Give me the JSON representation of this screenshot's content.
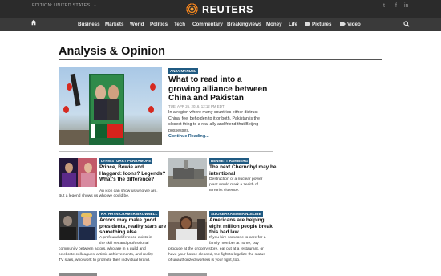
{
  "topbar": {
    "edition": "EDITION: UNITED STATES",
    "edition_chevron": "⌄",
    "logo_text": "REUTERS",
    "social": {
      "twitter": "t",
      "facebook": "f",
      "linkedin": "in"
    }
  },
  "nav": {
    "items": [
      "Business",
      "Markets",
      "World",
      "Politics",
      "Tech",
      "Commentary",
      "Breakingviews",
      "Money",
      "Life",
      "Pictures",
      "Video"
    ]
  },
  "page": {
    "title": "Analysis & Opinion"
  },
  "featured": {
    "author": "ANJA MANUEL",
    "title": "What to read into a growing alliance between China and Pakistan",
    "date": "TUE, APR 26, 2016, 12:12 PM EDT",
    "summary": "In a region where many countries either distrust China, feel beholden to it or both, Pakistan is the closest thing to a real ally and friend that Beijing possesses.",
    "continue": "Continue Reading..."
  },
  "stories": [
    {
      "author": "LYNN STUART PARRAMORE",
      "title": "Prince, Bowie and Haggard: Icons? Legends? What's the difference?",
      "summary": [
        "An icon can show us who we are.",
        "But a legend shows us who we could be."
      ]
    },
    {
      "author": "BENNETT RAMBERG",
      "title": "The next Chernobyl may be intentional",
      "summary": [
        "Destruction of a nuclear power",
        "plant would mark a zenith of",
        "terrorist violence."
      ]
    },
    {
      "author": "KATHRYN CRAMER BROWNELL",
      "title": "Actors may make good presidents, reality stars are something else",
      "summary": [
        "A profound difference exists in",
        "the skill set and professional",
        "community between actors, who are in a guild and",
        "celebrate colleagues' artistic achievements, and reality",
        "TV stars, who work to promote their individual brand."
      ]
    },
    {
      "author": "SIZOABAKA EMMA NZELIBE",
      "title": "Americans are helping eight million people break this bad law",
      "summary": [
        "If you hire someone to care for a",
        "family member at home, buy",
        "produce at the grocery store, eat out at a restaurant, or",
        "have your house cleaned, the fight to legalize the status",
        "of unauthorized workers is your fight, too."
      ]
    }
  ]
}
